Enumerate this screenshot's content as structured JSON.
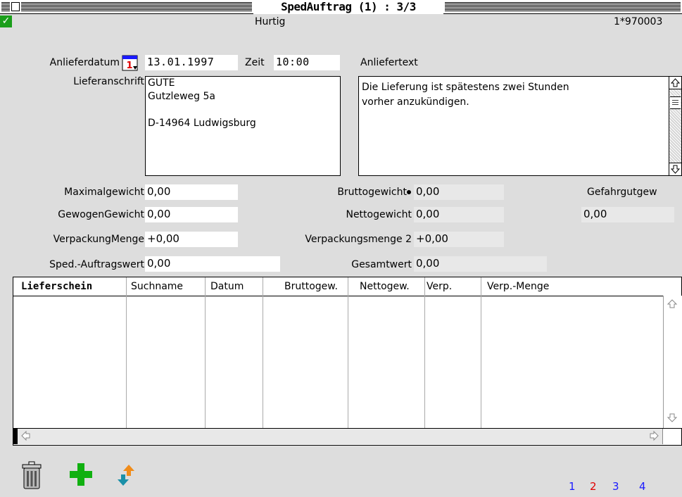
{
  "window": {
    "title": "SpedAuftrag (1) : 3/3"
  },
  "header": {
    "name": "Hurtig",
    "number": "1*970003",
    "ok_glyph": "✓"
  },
  "delivery": {
    "date_label": "Anlieferdatum",
    "date_value": "13.01.1997",
    "time_label": "Zeit",
    "time_value": "10:00",
    "text_label": "Anliefertext",
    "text_lines": [
      "Die Lieferung ist spätestens zwei Stunden",
      "vorher anzukündigen."
    ],
    "address_label": "Lieferanschrift",
    "address_lines": [
      "GUTE",
      "Gutzleweg 5a",
      "",
      "D-14964 Ludwigsburg"
    ]
  },
  "weights": {
    "max_label": "Maximalgewicht",
    "max_value": "0,00",
    "weighed_label": "GewogenGewicht",
    "weighed_value": "0,00",
    "pack_label": "VerpackungMenge",
    "pack_value": "+0,00",
    "order_value_label": "Sped.-Auftragswert",
    "order_value_value": "0,00",
    "gross_label": "Bruttogewicht",
    "gross_value": "0,00",
    "net_label": "Nettogewicht",
    "net_value": "0,00",
    "pack2_label": "Verpackungsmenge 2",
    "pack2_value": "+0,00",
    "total_label": "Gesamtwert",
    "total_value": "0,00",
    "hazard_label": "Gefahrgutgew",
    "hazard_value": "0,00"
  },
  "table": {
    "columns": [
      "Lieferschein",
      "Suchname",
      "Datum",
      "Bruttogew.",
      "Nettogew.",
      "Verp.",
      "Verp.-Menge"
    ]
  },
  "pages": {
    "items": [
      "1",
      "2",
      "3",
      "4"
    ],
    "colors": [
      "#1a1aff",
      "#e00000",
      "#1a1aff",
      "#1a1aff"
    ]
  },
  "colors": {
    "check_green": "#1b9e1b",
    "plus_green": "#10b010"
  },
  "icons": [
    "calendar-icon",
    "trash-icon",
    "plus-icon",
    "sort-arrows-icon",
    "scroll-up-icon",
    "scroll-down-icon",
    "scroll-left-icon",
    "scroll-right-icon"
  ]
}
